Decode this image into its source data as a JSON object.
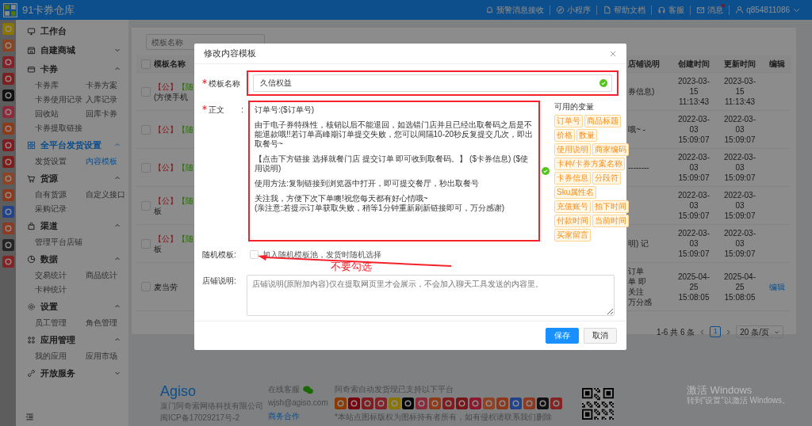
{
  "app": {
    "title": "91卡券仓库"
  },
  "topbar": {
    "links": [
      {
        "label": "预警消息接收",
        "unread": false
      },
      {
        "label": "小程序",
        "unread": false
      },
      {
        "label": "帮助文档",
        "unread": false
      },
      {
        "label": "客服",
        "unread": false
      },
      {
        "label": "消息",
        "unread": true
      }
    ],
    "user": "q854811086"
  },
  "sidebar": [
    {
      "kind": "link",
      "label": "工作台"
    },
    {
      "kind": "group",
      "label": "自建商城",
      "expanded": false,
      "selected": false
    },
    {
      "kind": "group",
      "label": "卡券",
      "expanded": true,
      "selected": false,
      "items": [
        {
          "label": "卡券库",
          "selected": false
        },
        {
          "label": "卡券方案",
          "selected": false
        },
        {
          "label": "卡券使用记录",
          "selected": false
        },
        {
          "label": "入库记录",
          "selected": false
        },
        {
          "label": "回收站",
          "selected": false
        },
        {
          "label": "回库卡券",
          "selected": false
        },
        {
          "label": "卡券提取链接",
          "selected": false
        }
      ]
    },
    {
      "kind": "group",
      "label": "全平台发货设置",
      "expanded": true,
      "selected": true,
      "items": [
        {
          "label": "发货设置",
          "selected": false
        },
        {
          "label": "内容模板",
          "selected": true
        }
      ]
    },
    {
      "kind": "group",
      "label": "货源",
      "expanded": true,
      "selected": false,
      "items": [
        {
          "label": "自有货源",
          "selected": false
        },
        {
          "label": "自定义接口",
          "selected": false
        },
        {
          "label": "采购记录",
          "selected": false
        }
      ]
    },
    {
      "kind": "group",
      "label": "渠道",
      "expanded": true,
      "selected": false,
      "items": [
        {
          "label": "管理平台店铺",
          "selected": false
        }
      ]
    },
    {
      "kind": "group",
      "label": "数据",
      "expanded": true,
      "selected": false,
      "items": [
        {
          "label": "交易统计",
          "selected": false
        },
        {
          "label": "商品统计",
          "selected": false
        },
        {
          "label": "卡种统计",
          "selected": false
        }
      ]
    },
    {
      "kind": "group",
      "label": "设置",
      "expanded": true,
      "selected": false,
      "items": [
        {
          "label": "员工管理",
          "selected": false
        },
        {
          "label": "角色管理",
          "selected": false
        }
      ]
    },
    {
      "kind": "group",
      "label": "应用管理",
      "expanded": true,
      "selected": false,
      "items": [
        {
          "label": "我的应用",
          "selected": false
        },
        {
          "label": "应用市场",
          "selected": false
        }
      ]
    },
    {
      "kind": "group",
      "label": "开放服务",
      "expanded": false,
      "selected": false
    }
  ],
  "toolbar": {
    "search_placeholder": "模板名称"
  },
  "table": {
    "columns": [
      "模板名称",
      "店铺说明",
      "创建时间",
      "更新时间",
      "编辑"
    ],
    "all_checked": false,
    "rows": [
      {
        "checked": false,
        "tags": [
          {
            "text": "【公】",
            "kind": "public"
          },
          {
            "text": "【随",
            "kind": "random"
          }
        ],
        "name_rest": "(方便手机",
        "note_lines": [
          "券信息)"
        ],
        "created_lines": [
          "2023-03-",
          "15",
          "11:13:43"
        ],
        "updated_lines": [
          "2023-03-",
          "15",
          "11:13:43"
        ]
      },
      {
        "checked": false,
        "tags": [
          {
            "text": "【公】",
            "kind": "public"
          },
          {
            "text": "【随",
            "kind": "random"
          }
        ],
        "note_lines": [
          "哦~ -"
        ],
        "created_lines": [
          "2022-03-",
          "03",
          "15:09:07"
        ],
        "updated_lines": [
          "2022-03-",
          "03",
          "15:09:07"
        ]
      },
      {
        "checked": false,
        "tags": [
          {
            "text": "【公】",
            "kind": "public"
          },
          {
            "text": "【随",
            "kind": "random"
          }
        ],
        "note_lines": [
          "--------"
        ],
        "created_lines": [
          "2022-03-",
          "03",
          "15:09:07"
        ],
        "updated_lines": [
          "2022-03-",
          "03",
          "15:09:07"
        ]
      },
      {
        "checked": false,
        "tags": [
          {
            "text": "【公】",
            "kind": "public"
          },
          {
            "text": "【随",
            "kind": "random"
          }
        ],
        "name_rest": "板",
        "created_lines": [
          "2022-03-",
          "03",
          "15:09:07"
        ],
        "updated_lines": [
          "2022-03-",
          "03",
          "15:09:07"
        ]
      },
      {
        "checked": false,
        "tags": [
          {
            "text": "【公】",
            "kind": "public"
          },
          {
            "text": "【随",
            "kind": "random"
          }
        ],
        "name_rest": "板",
        "note_lines": [
          "明) 记"
        ],
        "created_lines": [
          "2022-03-",
          "03",
          "15:09:07"
        ],
        "updated_lines": [
          "2022-03-",
          "03",
          "15:09:07"
        ]
      },
      {
        "checked": false,
        "name_rest": "麦当劳",
        "note_lines": [
          "订单",
          "单 即",
          "关注",
          "万分感"
        ],
        "created_lines": [
          "2025-04-",
          "25",
          "15:08:05"
        ],
        "updated_lines": [
          "2025-04-",
          "25",
          "15:08:05"
        ],
        "edit": "编辑"
      }
    ]
  },
  "pagination": {
    "summary": "1-6 共 6 条",
    "pages": [
      {
        "label": "1",
        "selected": true
      }
    ],
    "page_size": "20 条/页"
  },
  "modal": {
    "title": "修改内容模板",
    "name_field": {
      "label": "模板名称",
      "required": true,
      "value": "久信权益",
      "valid": true
    },
    "body_field": {
      "label": "正文",
      "colon": ":",
      "required": true,
      "valid": true,
      "paragraphs": [
        [
          "订单号:($订单号)"
        ],
        [
          "由于电子券特殊性，核销以后不能退回，如选错门店并且已经出取餐码之后是不能退款哦!!若订单高峰期订单提交失败，您可以间隔10-20秒反复提交几次，即出取餐号~"
        ],
        [
          "【点击下方链接 选择就餐门店 提交订单 即可收到取餐码。】 ($卡券信息) ($使用说明)"
        ],
        [
          "使用方法:复制链接到浏览器中打开，即可提交餐厅，秒出取餐号"
        ],
        [
          "关注我，方便下次下单噢!祝您每天都有好心情哦~",
          "(亲注意:若提示订单获取失败，稍等1分钟重新刷新链接即可，万分感谢)"
        ]
      ]
    },
    "variables_title": "可用的变量",
    "variables": [
      "订单号",
      "商品标题",
      "价格",
      "数量",
      "使用说明",
      "商家编码",
      "卡种/卡券方案名称",
      "卡券信息",
      "分段符",
      "Sku属性名",
      "充值账号",
      "拍下时间",
      "付款时间",
      "当前时间",
      "买家留言"
    ],
    "random": {
      "label": "随机模板:",
      "checked": false,
      "text": "加入随机模板池，发货时随机选择"
    },
    "shop_note": {
      "label": "店铺说明:",
      "placeholder": "店铺说明(原附加内容)仅在提取网页里才会展示，不会加入聊天工具发送的内容里。"
    },
    "buttons": [
      {
        "label": "保存",
        "kind": "primary"
      },
      {
        "label": "取消",
        "kind": "default"
      }
    ],
    "annotation": "不要勾选"
  },
  "footer": {
    "brand": "Agiso",
    "company": "厦门阿奇索网络科技有限公司",
    "icp": "闽ICP备17029217号-2",
    "service_label": "在线客服",
    "email": "wjsh@agiso.com",
    "business_link": "商务合作",
    "platforms_title": "阿奇索自动发货现已支持以下平台",
    "disclaimer": "*本站点图标版权为图标持有者所有，如有侵权请联系我们删除"
  },
  "os_notice": {
    "title": "激活 Windows",
    "subtitle": "转到“设置”以激活 Windows。"
  }
}
